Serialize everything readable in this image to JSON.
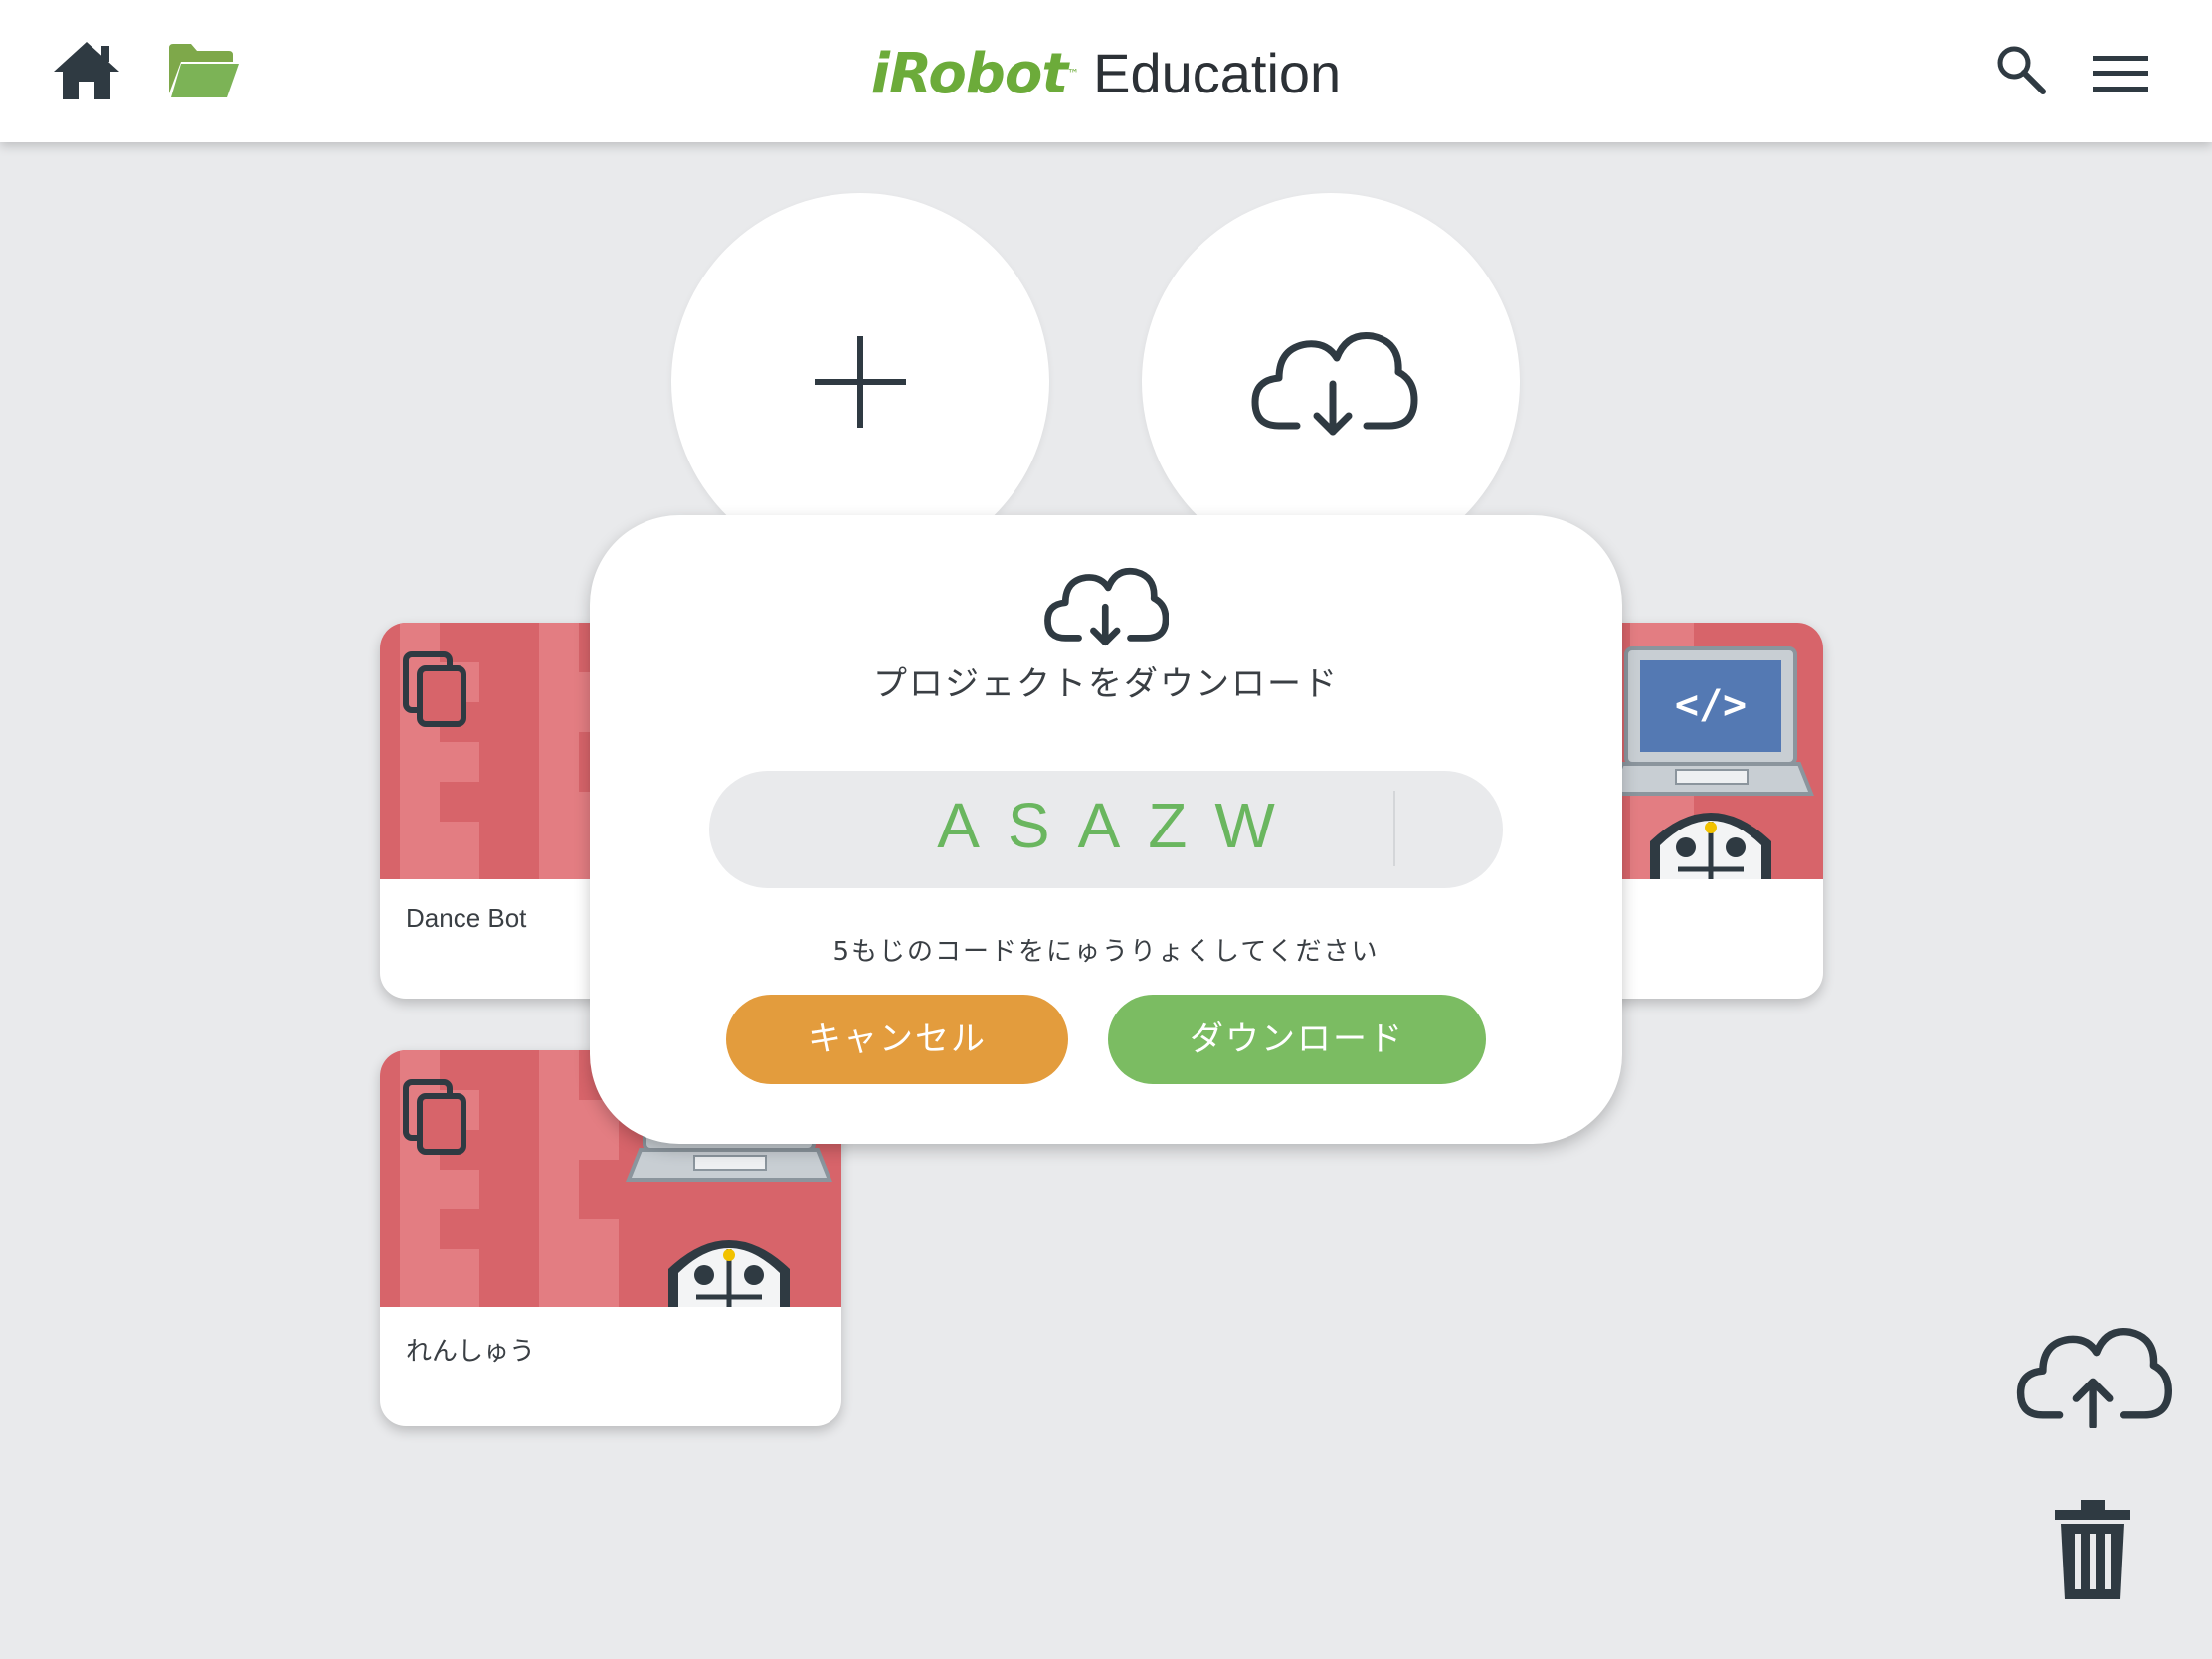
{
  "header": {
    "brand_logo": "iRobot",
    "brand_tm": "™",
    "brand_text": "Education",
    "home_icon": "home-icon",
    "folder_icon": "folder-open-icon",
    "search_icon": "search-icon",
    "menu_icon": "hamburger-menu-icon"
  },
  "actions": {
    "new_project_icon": "plus-icon",
    "download_icon": "cloud-download-icon"
  },
  "projects": [
    {
      "title": "Dance Bot",
      "thumbnail_icon": "copy-icon"
    },
    {
      "title": "",
      "thumbnail_icon": "laptop-robot-code-icon"
    },
    {
      "title": "れんしゅう",
      "thumbnail_icon": "copy-icon"
    }
  ],
  "dialog": {
    "icon": "cloud-download-icon",
    "title": "プロジェクトをダウンロード",
    "code_value": "ASAZW",
    "hint": "5もじのコードをにゅうりょくしてください",
    "cancel_label": "キャンセル",
    "download_label": "ダウンロード"
  },
  "sidebar_actions": {
    "upload_icon": "cloud-upload-icon",
    "delete_icon": "trash-icon"
  },
  "colors": {
    "brand_green": "#6cab3a",
    "cancel_orange": "#e39c3d",
    "download_green": "#7bbc62",
    "code_green": "#6ab65f",
    "card_red": "#d7646a",
    "background": "#e9eaec"
  }
}
